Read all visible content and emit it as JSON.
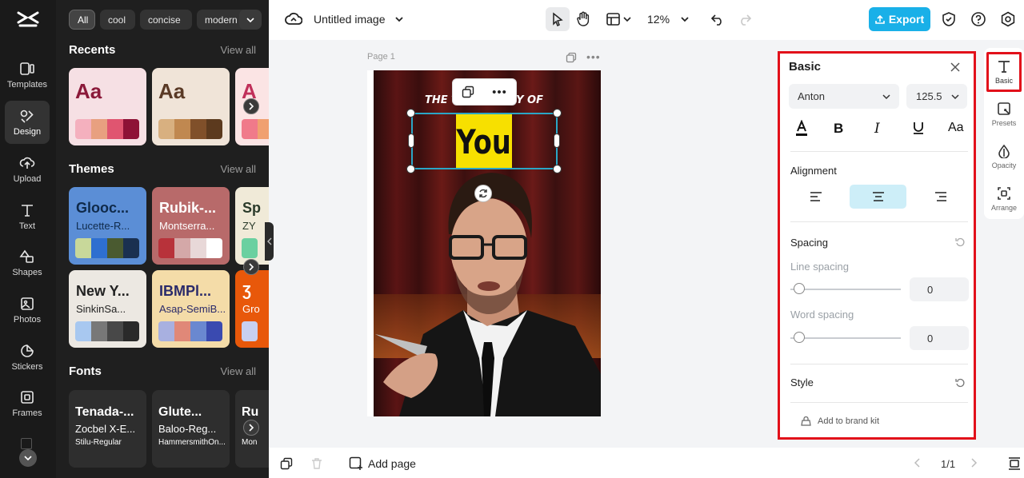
{
  "rail": {
    "items": [
      {
        "label": "Templates"
      },
      {
        "label": "Design"
      },
      {
        "label": "Upload"
      },
      {
        "label": "Text"
      },
      {
        "label": "Shapes"
      },
      {
        "label": "Photos"
      },
      {
        "label": "Stickers"
      },
      {
        "label": "Frames"
      }
    ]
  },
  "panel": {
    "chips": [
      "All",
      "cool",
      "concise",
      "modern"
    ],
    "recents": {
      "title": "Recents",
      "view_all": "View all",
      "cards": [
        {
          "text": "Aa",
          "text_color": "#8b1a3a",
          "bg": "#f6e0e4",
          "swatches": [
            "#f4b0be",
            "#e8a080",
            "#e05570",
            "#8e1236"
          ]
        },
        {
          "text": "Aa",
          "text_color": "#5a3a26",
          "bg": "#f0e4d8",
          "swatches": [
            "#d8b080",
            "#c08850",
            "#80502a",
            "#5c3a1e"
          ]
        },
        {
          "text": "A",
          "text_color": "#c0305a",
          "bg": "#fbe4e4",
          "swatches": [
            "#f07a8a",
            "#f0a070"
          ]
        }
      ]
    },
    "themes": {
      "title": "Themes",
      "view_all": "View all",
      "cards": [
        {
          "title": "Glooc...",
          "sub": "Lucette-R...",
          "bg": "#5b8ed6",
          "fg": "#0f2a4a",
          "swatches": [
            "#c8d89a",
            "#2e6fd0",
            "#4a5a30",
            "#1a3050"
          ]
        },
        {
          "title": "Rubik-...",
          "sub": "Montserra...",
          "bg": "#b86a6a",
          "fg": "#ffffff",
          "swatches": [
            "#b8323a",
            "#d4a8a8",
            "#e8d8d8",
            "#ffffff"
          ]
        },
        {
          "title": "Sp",
          "sub": "ZY",
          "bg": "#f0ead8",
          "fg": "#2a3a2a",
          "swatches": [
            "#6ad0a0"
          ]
        },
        {
          "title": "New Y...",
          "sub": "SinkinSa...",
          "bg": "#ece8e2",
          "fg": "#222222",
          "swatches": [
            "#a8c8f0",
            "#787878",
            "#484848",
            "#2a2a2a"
          ]
        },
        {
          "title": "IBMPl...",
          "sub": "Asap-SemiB...",
          "bg": "#f4dca8",
          "fg": "#2a2a6a",
          "swatches": [
            "#a8b0e0",
            "#e08878",
            "#6a88d0",
            "#3a4ab0"
          ]
        },
        {
          "title": "Ʒ",
          "sub": "Gro",
          "bg": "#e8580a",
          "fg": "#ffffff",
          "swatches": [
            "#c8d0f0"
          ]
        }
      ]
    },
    "fonts": {
      "title": "Fonts",
      "view_all": "View all",
      "cards": [
        {
          "l1": "Tenada-...",
          "l2": "Zocbel X-E...",
          "l3": "Stilu-Regular"
        },
        {
          "l1": "Glute...",
          "l2": "Baloo-Reg...",
          "l3": "HammersmithOn..."
        },
        {
          "l1": "Ru",
          "l2": "",
          "l3": "Mon"
        }
      ]
    }
  },
  "topbar": {
    "doc_title": "Untitled image",
    "zoom": "12%",
    "export_label": "Export"
  },
  "canvas": {
    "page_label": "Page 1",
    "headline": "THE TRUE STORY OF",
    "highlight_word": "You"
  },
  "bottombar": {
    "add_page": "Add page",
    "pager": "1/1"
  },
  "props": {
    "title": "Basic",
    "font": "Anton",
    "font_size": "125.5",
    "alignment_label": "Alignment",
    "spacing_label": "Spacing",
    "line_spacing_label": "Line spacing",
    "line_spacing_value": "0",
    "word_spacing_label": "Word spacing",
    "word_spacing_value": "0",
    "style_label": "Style",
    "brand_kit": "Add to brand kit"
  },
  "tabs": [
    {
      "label": "Basic"
    },
    {
      "label": "Presets"
    },
    {
      "label": "Opacity"
    },
    {
      "label": "Arrange"
    }
  ],
  "colors": {
    "accent": "#19b0e8",
    "highlight": "#e2101a",
    "selection": "#2aa6c6",
    "yellow": "#f7e000"
  }
}
